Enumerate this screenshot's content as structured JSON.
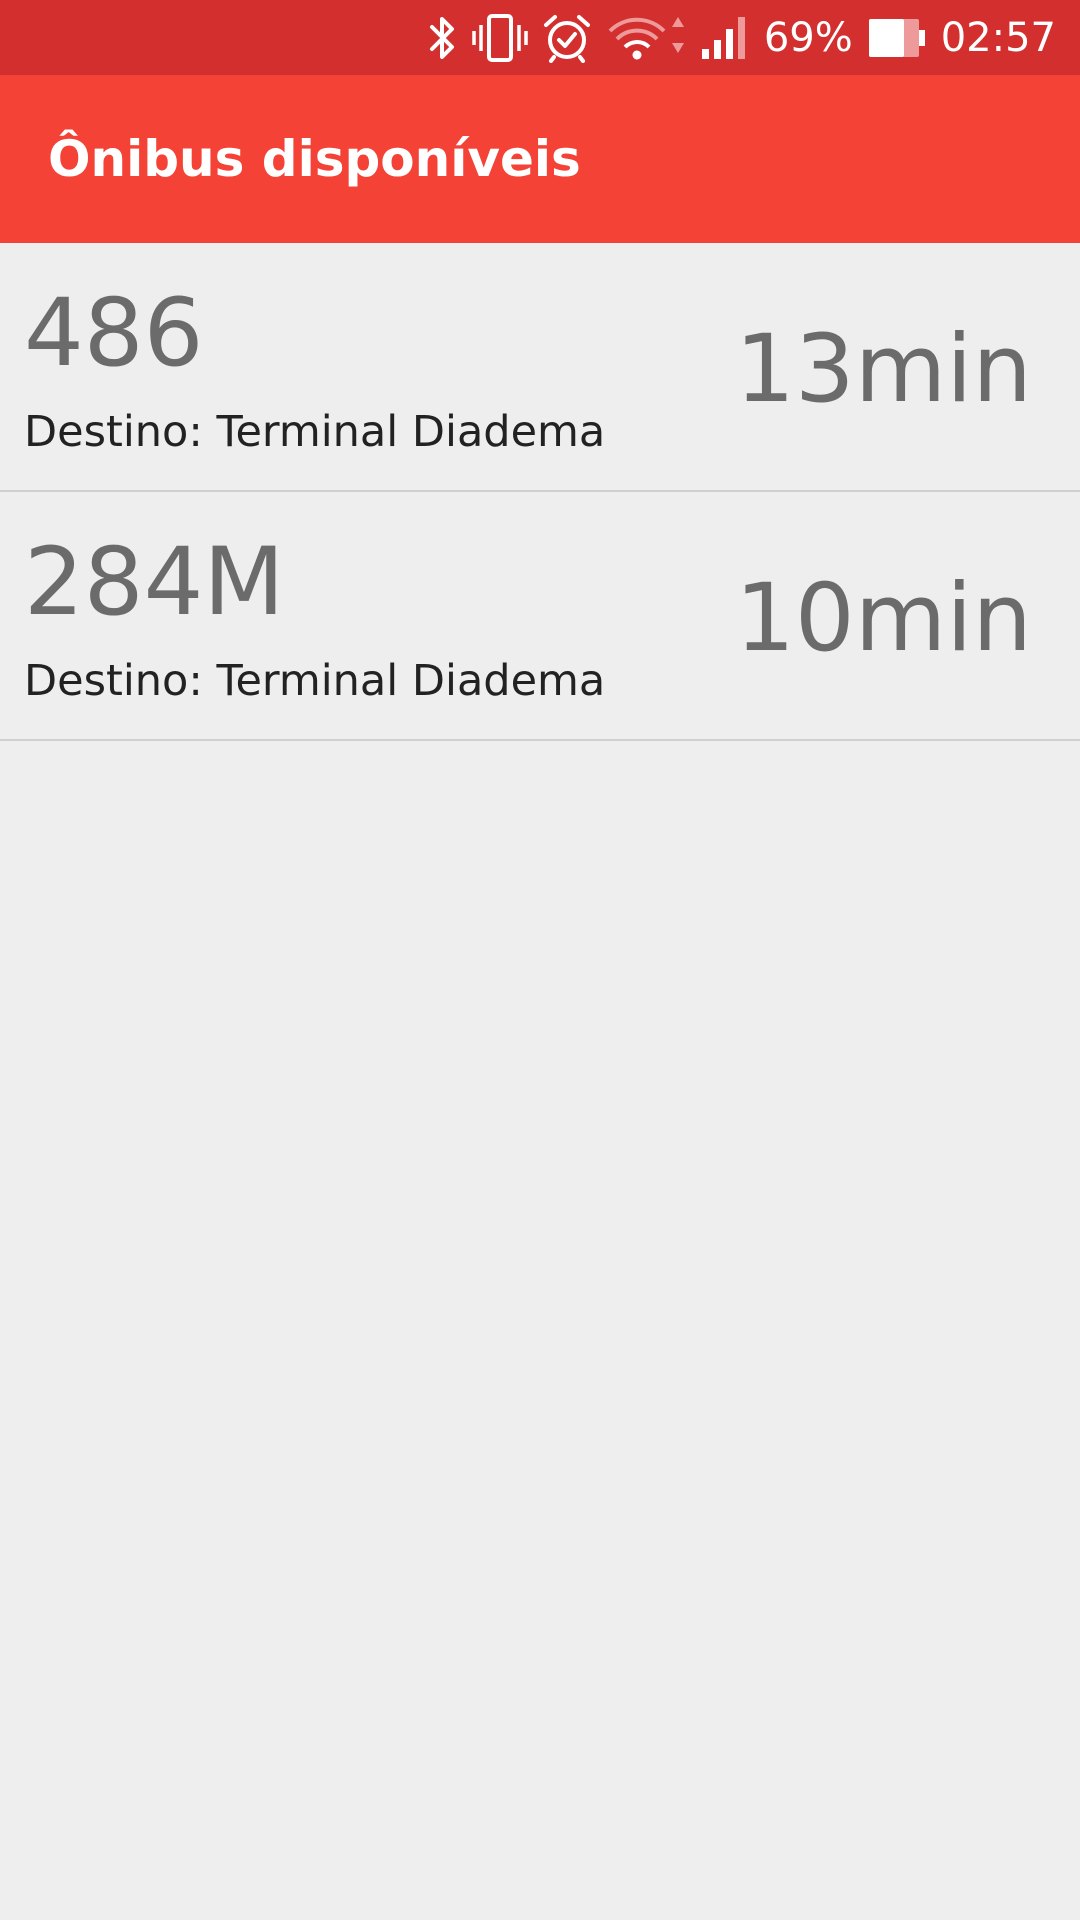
{
  "status_bar": {
    "icons": [
      "bluetooth-icon",
      "vibrate-icon",
      "alarm-icon",
      "wifi-icon",
      "signal-icon",
      "battery-icon"
    ],
    "battery": "69%",
    "time": "02:57",
    "background": "#d32f2f"
  },
  "app_bar": {
    "title": "Ônibus disponíveis",
    "background": "#f44336"
  },
  "buses": [
    {
      "line": "486",
      "destination": "Destino: Terminal Diadema",
      "eta": "13min"
    },
    {
      "line": "284M",
      "destination": "Destino: Terminal Diadema",
      "eta": "10min"
    }
  ]
}
